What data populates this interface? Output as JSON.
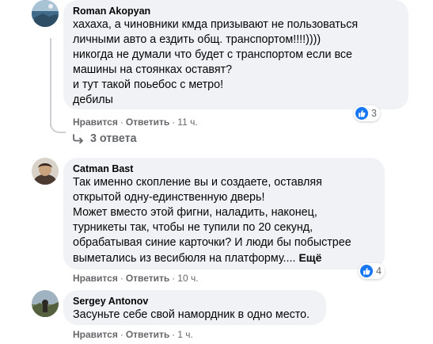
{
  "comments": [
    {
      "author": "Roman Akopyan",
      "text": "хахаха, а чиновники кмда призывают не пользоваться\nличными авто а ездить общ. транспортом!!!!))))\nникогда не думали что будет с транспортом если все\nмашины на стоянках оставят?\nи тут такой поьебос с метро!\nдебилы",
      "like_label": "Нравится",
      "reply_label": "Ответить",
      "time": "11 ч.",
      "reaction_count": "3",
      "replies_label": "3 ответа"
    },
    {
      "author": "Catman Bast",
      "text": "Так именно скопление вы и создаете, оставляя\nоткрытой одну-единственную дверь!\nМожет вместо этой фигни, наладить, наконец,\nтурникеты так, чтобы не тупили по 20 секунд,\nобрабатывая синие карточки? И люди бы побыстрее\nвыметались из весибюля на платформу....",
      "more_label": "Ещё",
      "like_label": "Нравится",
      "reply_label": "Ответить",
      "time": "10 ч.",
      "reaction_count": "4"
    },
    {
      "author": "Sergey Antonov",
      "text": "Засуньте себе свой намордник в одно место.",
      "like_label": "Нравится",
      "reply_label": "Ответить",
      "time": "1 ч."
    }
  ],
  "colors": {
    "bubble_bg": "#f0f2f5",
    "secondary_text": "#65676b",
    "like_blue": "#1877f2"
  }
}
